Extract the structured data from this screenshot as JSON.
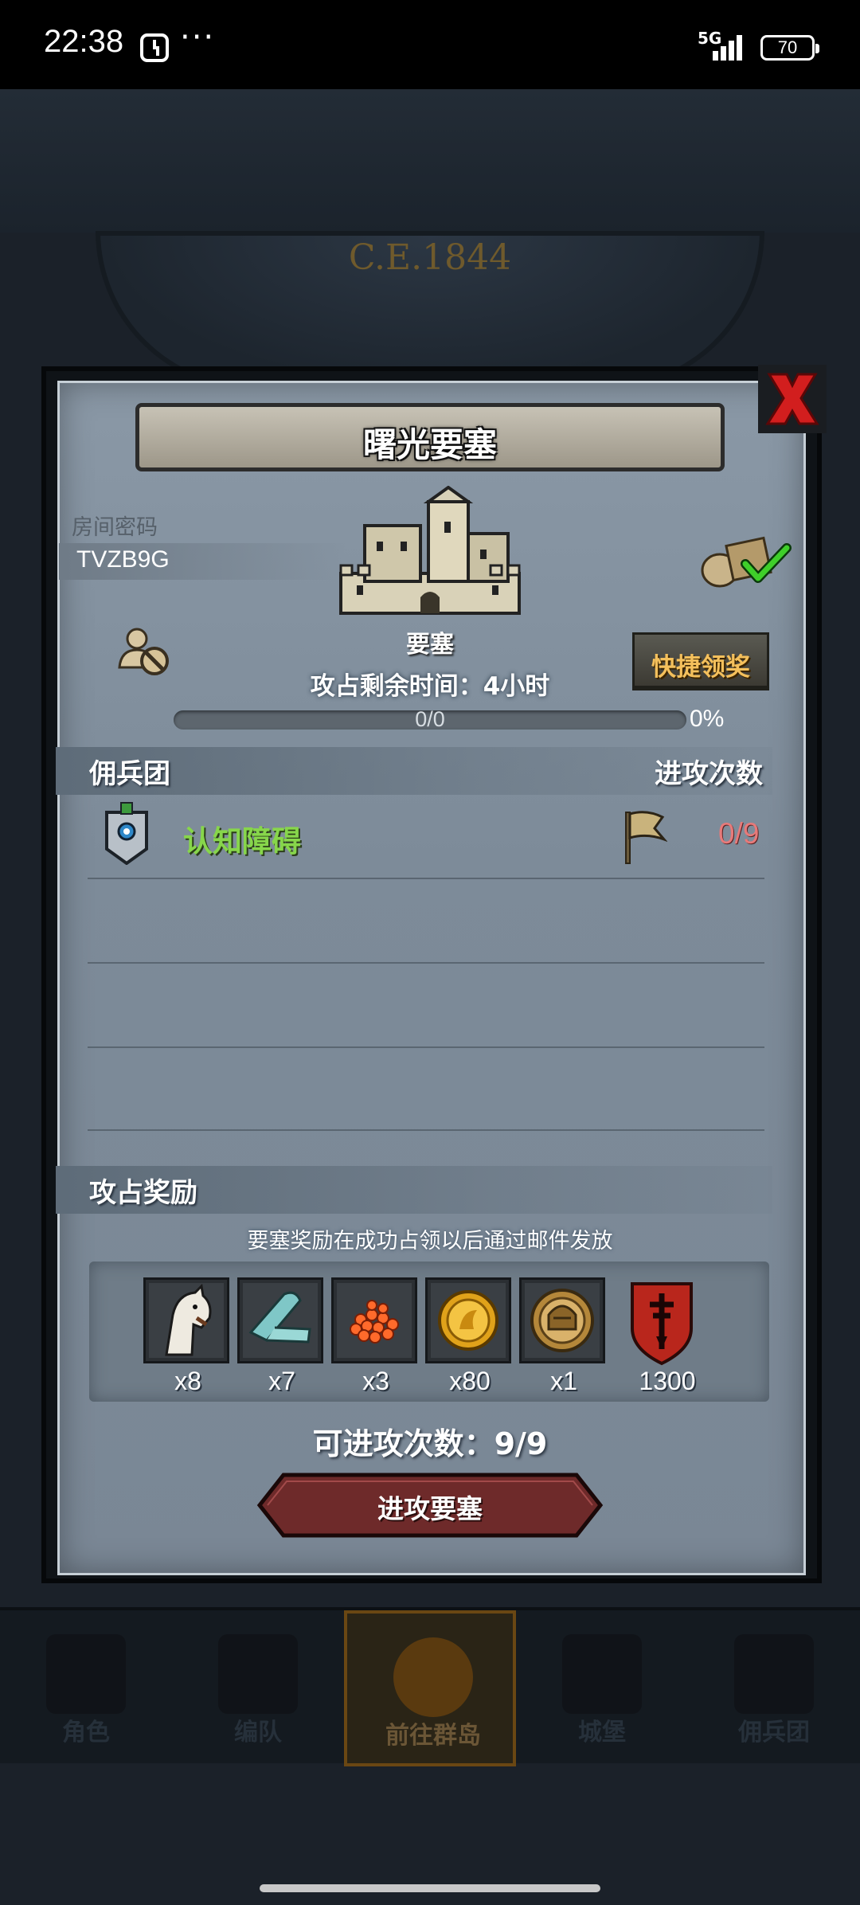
{
  "status_bar": {
    "time": "22:38",
    "more": "···",
    "network": "5G",
    "battery": "70"
  },
  "background": {
    "era": "C.E.1844"
  },
  "tabs": [
    {
      "label": "角色"
    },
    {
      "label": "编队"
    },
    {
      "label": "前往群岛"
    },
    {
      "label": "城堡"
    },
    {
      "label": "佣兵团"
    }
  ],
  "modal": {
    "title": "曙光要塞",
    "room": {
      "label": "房间密码",
      "code": "TVZB9G"
    },
    "fortress": {
      "label": "要塞",
      "icon": "castle-icon"
    },
    "quick_claim_label": "快捷领奖",
    "remaining_time": "攻占剩余时间：4小时",
    "progress": {
      "text": "0/0",
      "percent_text": "0%",
      "fraction": 0
    },
    "mercenary_section": {
      "title": "佣兵团",
      "attack_count_title": "进攻次数"
    },
    "mercenaries": [
      {
        "name": "认知障碍",
        "attacks": "0/9",
        "icon": "guild-banner-icon"
      }
    ],
    "rewards_section": {
      "title": "攻占奖励",
      "note": "要塞奖励在成功占领以后通过邮件发放",
      "items": [
        {
          "icon": "horse-icon",
          "qty": "x8"
        },
        {
          "icon": "cloth-icon",
          "qty": "x7"
        },
        {
          "icon": "roe-icon",
          "qty": "x3"
        },
        {
          "icon": "gold-coin-icon",
          "qty": "x80"
        },
        {
          "icon": "helmet-medal-icon",
          "qty": "x1"
        },
        {
          "icon": "red-shield-icon",
          "qty": "1300"
        }
      ]
    },
    "available_attacks": "可进攻次数：9/9",
    "attack_button": "进攻要塞"
  },
  "colors": {
    "panel": "#8a98a6",
    "accent_gold": "#f4c05c",
    "merc_name": "#87d64b",
    "attack_count": "#e77a7a",
    "attack_button": "#7a2c2c"
  }
}
